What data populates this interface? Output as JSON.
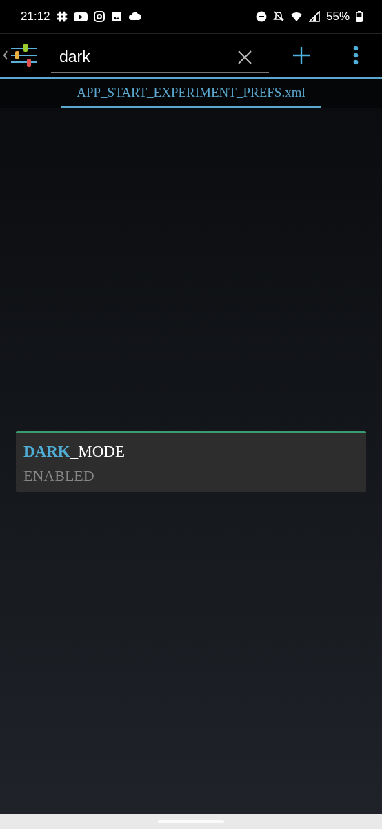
{
  "status_bar": {
    "time": "21:12",
    "battery": "55%"
  },
  "toolbar": {
    "search": {
      "value": "dark"
    }
  },
  "tabs": [
    {
      "label": "APP_START_EXPERIMENT_PREFS.xml",
      "selected": true
    }
  ],
  "preferences": [
    {
      "key": "**DARK**_MODE",
      "value": "ENABLED"
    }
  ]
}
